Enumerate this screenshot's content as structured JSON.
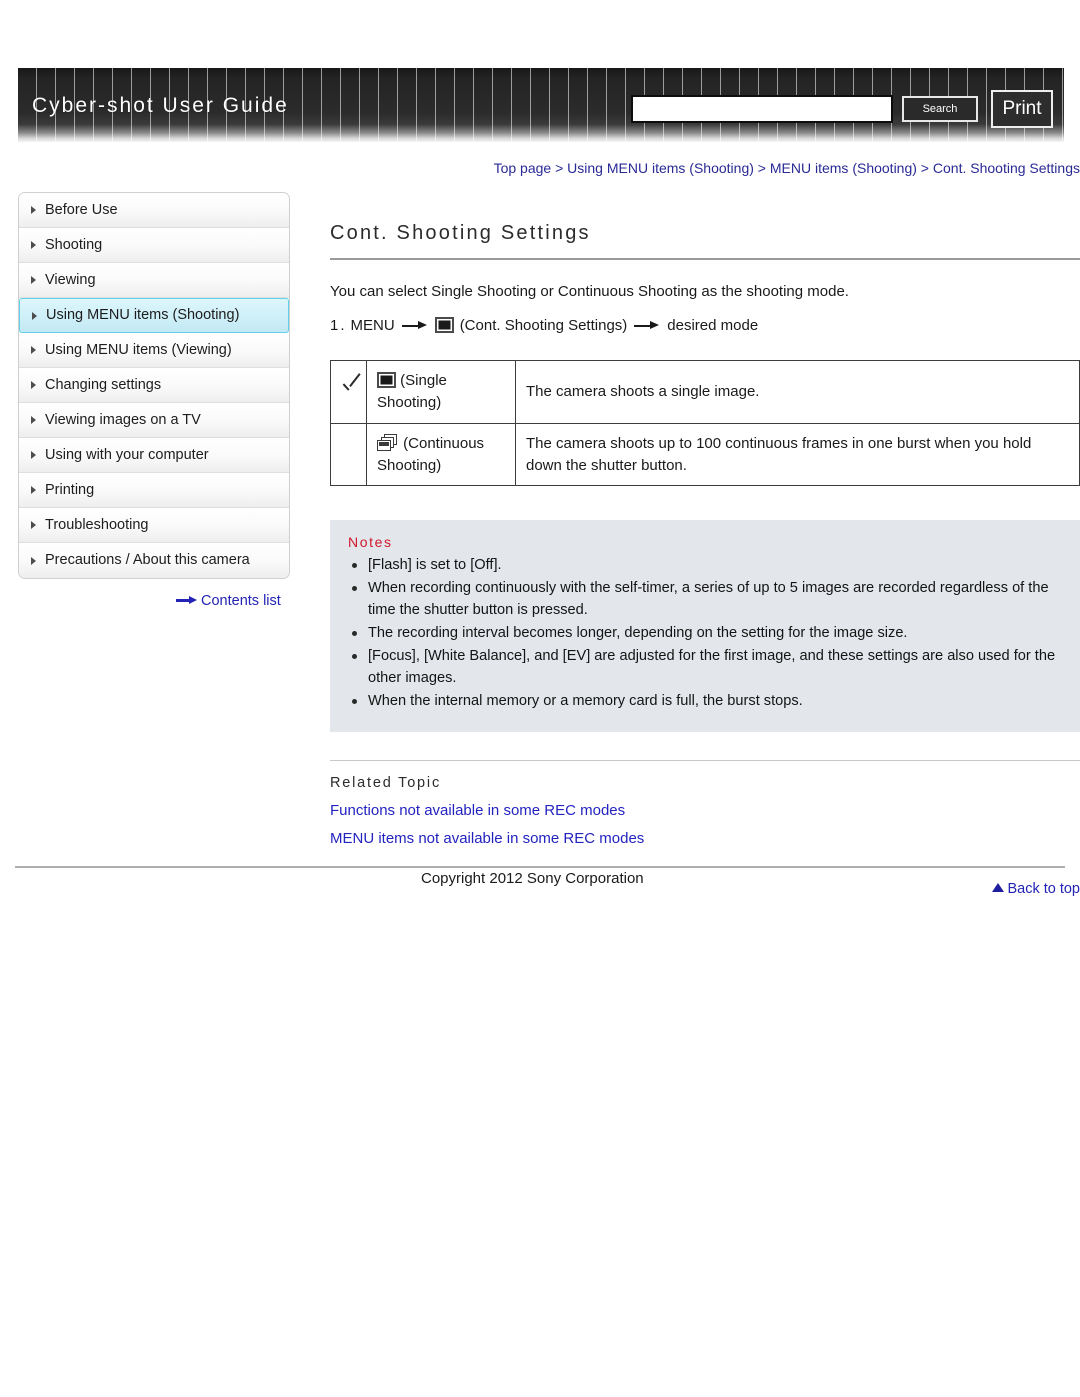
{
  "header": {
    "title": "Cyber-shot User Guide",
    "search_value": "",
    "search_placeholder": "",
    "search_label": "Search",
    "print_label": "Print"
  },
  "sidebar": {
    "items": [
      {
        "label": "Before Use",
        "active": false
      },
      {
        "label": "Shooting",
        "active": false
      },
      {
        "label": "Viewing",
        "active": false
      },
      {
        "label": "Using MENU items (Shooting)",
        "active": true
      },
      {
        "label": "Using MENU items (Viewing)",
        "active": false
      },
      {
        "label": "Changing settings",
        "active": false
      },
      {
        "label": "Viewing images on a TV",
        "active": false
      },
      {
        "label": "Using with your computer",
        "active": false
      },
      {
        "label": "Printing",
        "active": false
      },
      {
        "label": "Troubleshooting",
        "active": false
      },
      {
        "label": "Precautions / About this camera",
        "active": false
      }
    ],
    "contents_list_label": "Contents list"
  },
  "breadcrumb": {
    "item0": "Top page",
    "sep0": " > ",
    "item1": "Using MENU items (Shooting)",
    "sep1": " > ",
    "item2": "MENU items (Shooting)",
    "sep2": " > ",
    "item3": "Cont. Shooting Settings"
  },
  "main": {
    "page_title": "Cont. Shooting Settings",
    "intro": "You can select Single Shooting or Continuous Shooting as the shooting mode.",
    "step": {
      "number": "1.",
      "menu_label": "MENU",
      "icon_label": "(Cont. Shooting Settings)",
      "tail": "desired mode"
    },
    "table": {
      "rows": [
        {
          "checked": true,
          "mode": "(Single Shooting)",
          "description": "The camera shoots a single image."
        },
        {
          "checked": false,
          "mode": "(Continuous Shooting)",
          "description": "The camera shoots up to 100 continuous frames in one burst when you hold down the shutter button."
        }
      ]
    },
    "notes": {
      "title": "Notes",
      "items": [
        "[Flash] is set to [Off].",
        "When recording continuously with the self-timer, a series of up to 5 images are recorded regardless of the time the shutter button is pressed.",
        "The recording interval becomes longer, depending on the setting for the image size.",
        "[Focus], [White Balance], and [EV] are adjusted for the first image, and these settings are also used for the other images.",
        "When the internal memory or a memory card is full, the burst stops."
      ]
    },
    "related": {
      "title": "Related Topic",
      "links": [
        "Functions not available in some REC modes",
        "MENU items not available in some REC modes"
      ]
    },
    "back_to_top": "Back to top"
  },
  "footer": {
    "copyright": "Copyright 2012 Sony Corporation"
  },
  "colors": {
    "accent_link": "#2323c0",
    "breadcrumb": "#2a2a96",
    "notes_title": "#d0182b",
    "notes_bg": "#e3e7ec",
    "active_nav_bg": "#cfeff8",
    "active_nav_border": "#63d2e8",
    "header_bg": "#242424"
  }
}
